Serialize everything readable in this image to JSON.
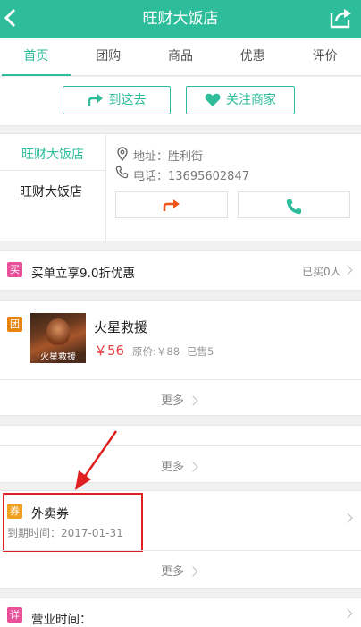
{
  "header": {
    "title": "旺财大饭店",
    "back_icon": "chevron-left-icon",
    "share_icon": "share-icon"
  },
  "tabs": [
    {
      "label": "首页",
      "active": true
    },
    {
      "label": "团购",
      "active": false
    },
    {
      "label": "商品",
      "active": false
    },
    {
      "label": "优惠",
      "active": false
    },
    {
      "label": "评价",
      "active": false
    }
  ],
  "actions": {
    "go_label": "到这去",
    "follow_label": "关注商家"
  },
  "store": {
    "selected_name": "旺财大饭店",
    "other_name": "旺财大饭店",
    "address": "地址：胜利街",
    "phone": "电话：13695602847"
  },
  "promo": {
    "badge": "买",
    "text": "买单立享9.0折优惠",
    "bought": "已买0人"
  },
  "group_deal": {
    "badge": "团",
    "poster_text": "火星救援",
    "name": "火星救援",
    "price": "￥56",
    "original_price": "原价:￥88",
    "sold": "已售5",
    "more": "更多"
  },
  "empty_section": {
    "more": "更多"
  },
  "coupon": {
    "badge": "券",
    "title": "外卖券",
    "expiry": "到期时间：2017-01-31",
    "more": "更多"
  },
  "details": {
    "badge": "详",
    "title": "营业时间："
  },
  "colors": {
    "accent": "#2dbd9a",
    "price": "#e84343",
    "highlight": "#e02020",
    "badge_pink": "#e8509a",
    "badge_orange": "#e8850f",
    "badge_amber": "#f0a020"
  }
}
